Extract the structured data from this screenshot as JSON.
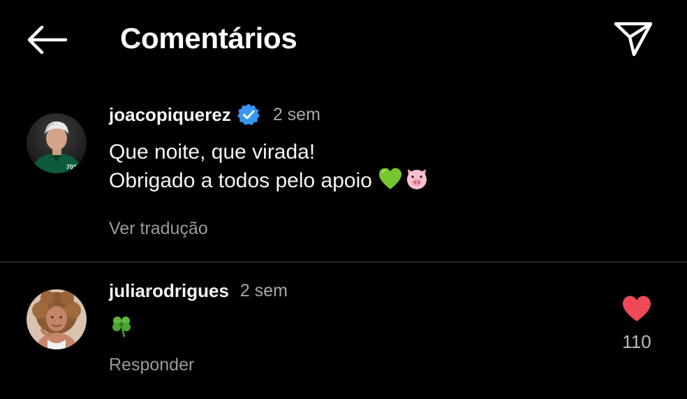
{
  "header": {
    "title": "Comentários",
    "back_icon": "arrow-left-icon",
    "share_icon": "paper-plane-icon"
  },
  "comments": [
    {
      "username": "joacopiquerez",
      "verified": true,
      "timestamp": "2 sem",
      "lines": [
        "Que noite, que virada!",
        "Obrigado a todos pelo apoio"
      ],
      "emojis": [
        "green-heart-icon",
        "pig-face-icon"
      ],
      "action_label": "Ver tradução"
    },
    {
      "username": "juliarodrigues",
      "verified": false,
      "timestamp": "2 sem",
      "emojis": [
        "four-leaf-clover-icon"
      ],
      "action_label": "Responder",
      "liked": true,
      "like_count": "110"
    }
  ],
  "colors": {
    "background": "#000000",
    "text_primary": "#ffffff",
    "text_secondary": "#a8a8a8",
    "verified_badge": "#3897f0",
    "like_red": "#ed4956",
    "divider": "#262626"
  }
}
